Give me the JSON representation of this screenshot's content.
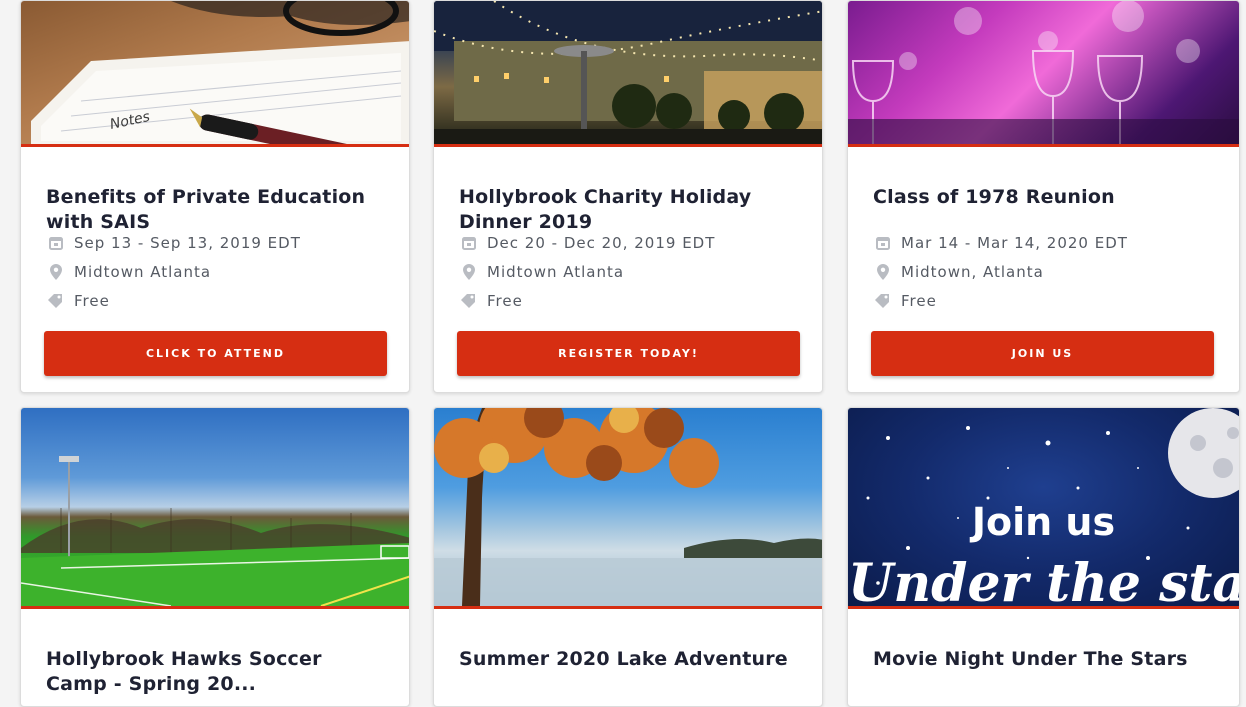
{
  "cards": [
    {
      "title": "Benefits of Private Education with SAIS",
      "date": "Sep 13 - Sep 13, 2019 EDT",
      "location": "Midtown Atlanta",
      "price": "Free",
      "cta": "CLICK TO ATTEND",
      "image_handwriting": "Notes"
    },
    {
      "title": "Hollybrook Charity Holiday Dinner 2019",
      "date": "Dec 20 - Dec 20, 2019 EDT",
      "location": "Midtown Atlanta",
      "price": "Free",
      "cta": "REGISTER TODAY!"
    },
    {
      "title": "Class of 1978 Reunion",
      "date": "Mar 14 - Mar 14, 2020 EDT",
      "location": "Midtown, Atlanta",
      "price": "Free",
      "cta": "JOIN US"
    },
    {
      "title": "Hollybrook Hawks Soccer Camp - Spring 20..."
    },
    {
      "title": "Summer 2020 Lake Adventure"
    },
    {
      "title": "Movie Night Under The Stars",
      "image_text_line1": "Join us",
      "image_text_line2": "Under the stars"
    }
  ],
  "icons": {
    "date": "calendar-icon",
    "location": "map-pin-icon",
    "price": "tag-icon"
  },
  "colors": {
    "accent": "#d62e12",
    "title": "#1f2233",
    "meta": "#555a63",
    "icon": "#b9bcc2"
  }
}
